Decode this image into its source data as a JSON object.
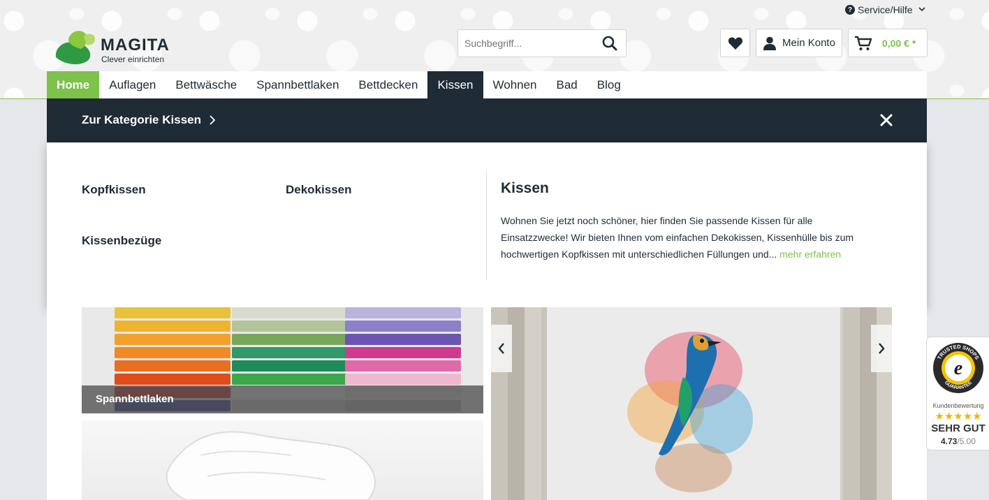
{
  "header": {
    "service_label": "Service/Hilfe",
    "logo": {
      "brand": "MAGITA",
      "slogan": "Clever einrichten"
    },
    "search": {
      "placeholder": "Suchbegriff..."
    },
    "account_label": "Mein Konto",
    "cart_total": "0,00 € *"
  },
  "nav": {
    "items": [
      "Home",
      "Auflagen",
      "Bettwäsche",
      "Spannbettlaken",
      "Bettdecken",
      "Kissen",
      "Wohnen",
      "Bad",
      "Blog"
    ],
    "active": "Kissen"
  },
  "menu": {
    "category_link": "Zur Kategorie Kissen",
    "categories": [
      "Kopfkissen",
      "Dekokissen",
      "Kissenbezüge"
    ],
    "teaser": {
      "title": "Kissen",
      "text": "Wohnen Sie jetzt noch schöner, hier finden Sie passende Kissen für alle Einsatzzwecke! Wir bieten Ihnen vom einfachen Dekokissen, Kissenhülle bis zum hochwertigen Kopfkissen mit unterschiedlichen Füllungen und...",
      "more": "mehr erfahren"
    }
  },
  "content": {
    "tile_caption": "Spannbettlaken"
  },
  "trusted_shops": {
    "seal_top": "TRUSTED SHOPS",
    "seal_bottom": "GUARANTEE",
    "label": "Kundenbewertung",
    "grade": "SEHR GUT",
    "score": "4.73",
    "max": "/5.00"
  },
  "colors": {
    "accent_green": "#7cc24b",
    "dark_navy": "#1f2b35"
  }
}
